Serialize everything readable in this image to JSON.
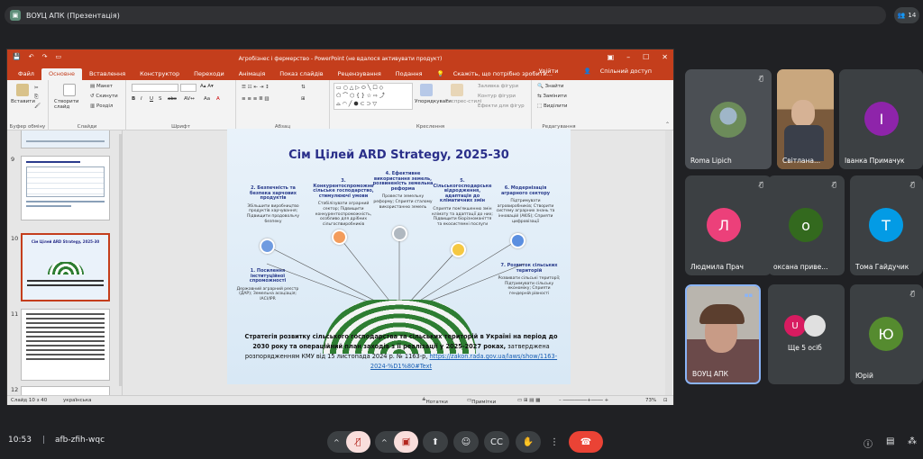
{
  "meeting": {
    "title": "ВОУЦ АПК (Презентація)",
    "participants_count": "14",
    "time": "10:53",
    "code": "afb-zfih-wqc"
  },
  "ppt": {
    "window_title": "Агробізнес і фермерство - PowerPoint (не вдалося активувати продукт)",
    "tabs": [
      "Файл",
      "Основне",
      "Вставлення",
      "Конструктор",
      "Переходи",
      "Анімація",
      "Показ слайдів",
      "Рецензування",
      "Подання"
    ],
    "search_hint": "Скажіть, що потрібно зробити...",
    "signin": "Увійти",
    "share": "Спільний доступ",
    "groups": {
      "clipboard": "Буфер обміну",
      "slides": "Слайди",
      "font": "Шрифт",
      "paragraph": "Абзац",
      "drawing": "Креслення",
      "editing": "Редагування"
    },
    "buttons": {
      "paste": "Вставити",
      "new_slide": "Створити слайд",
      "layout": "Макет",
      "reset": "Скинути",
      "section": "Розділ",
      "arrange": "Упорядкувати",
      "quick_styles": "Експрес-стилі",
      "shape_fill": "Заливка фігури",
      "shape_outline": "Контур фігури",
      "shape_effects": "Ефекти для фігур",
      "find": "Знайти",
      "replace": "Замінити",
      "select": "Виділити"
    },
    "thumb_numbers": [
      "9",
      "10",
      "11",
      "12"
    ],
    "status": {
      "slide": "Слайд 10 з 40",
      "language": "українська",
      "notes": "Нотатки",
      "comments": "Примітки",
      "zoom": "73%"
    }
  },
  "slide": {
    "title": "Сім Цілей ARD Strategy, 2025-30",
    "goals": [
      {
        "head": "2. Безпечність та безпека харчових продуктів",
        "body": "Збільшити виробництво продуктів харчування; Підвищити продовольчу безпеку"
      },
      {
        "head": "3. Конкурентоспроможне сільське господарство, стимулюючі умови",
        "body": "Стабілізувати аграрний сектор; Підвищити конкурентоспроможність, особливо для дрібних сільгоспвиробників"
      },
      {
        "head": "4. Ефективне використання земель, розвиненість земельна реформа",
        "body": "Провести земельну реформу; Сприяти сталому використанню земель"
      },
      {
        "head": "5. Сільськогосподарське відродження, адаптація до кліматичних змін",
        "body": "Сприяти пом'якшенню змін клімату та адаптації до них; Підвищити біорізноманіття та екосистемні послуги"
      },
      {
        "head": "6. Модернізація аграрного сектору",
        "body": "Підтримувати агровиробників; Створити систему аграрних знань та інновацій (AKIS); Сприяти цифровізації"
      },
      {
        "head": "1. Посилення інституційної спроможності",
        "body": "Державний аграрний реєстр (ДАР); Земельна асоціація; ІАСІ/IPR"
      },
      {
        "head": "7. Розвиток сільських територій",
        "body": "Розвивати сільські території; Підтримувати сільську економіку; Сприяти гендерній рівності"
      }
    ],
    "caption_bold": "Стратегія розвитку сільського господарства та сільських територій в Україні на період до 2030 року та операційний план заходів з її реалізації у 2025-2027 роках,",
    "caption_rest": " затверджена розпорядженням КМУ від 15 листопада 2024 р. № 1163-р,",
    "caption_link": "https://zakon.rada.gov.ua/laws/show/1163-2024-%D1%80#Text"
  },
  "tiles": [
    {
      "name": "Roma Lipich",
      "initial": "",
      "color": ""
    },
    {
      "name": "Світлана...",
      "initial": "",
      "color": ""
    },
    {
      "name": "Іванка Примачук",
      "initial": "І",
      "color": "#8e24aa"
    },
    {
      "name": "Людмила Прач",
      "initial": "Л",
      "color": "#ec407a"
    },
    {
      "name": "оксана приве...",
      "initial": "о",
      "color": "#33691e"
    },
    {
      "name": "Тома Гайдучик",
      "initial": "Т",
      "color": "#039be5"
    },
    {
      "name": "ВОУЦ АПК",
      "initial": "",
      "color": ""
    },
    {
      "name": "Ще 5 осіб",
      "initial": "U",
      "color": "#d81b60"
    },
    {
      "name": "Юрій",
      "initial": "Ю",
      "color": "#558b2f"
    }
  ]
}
